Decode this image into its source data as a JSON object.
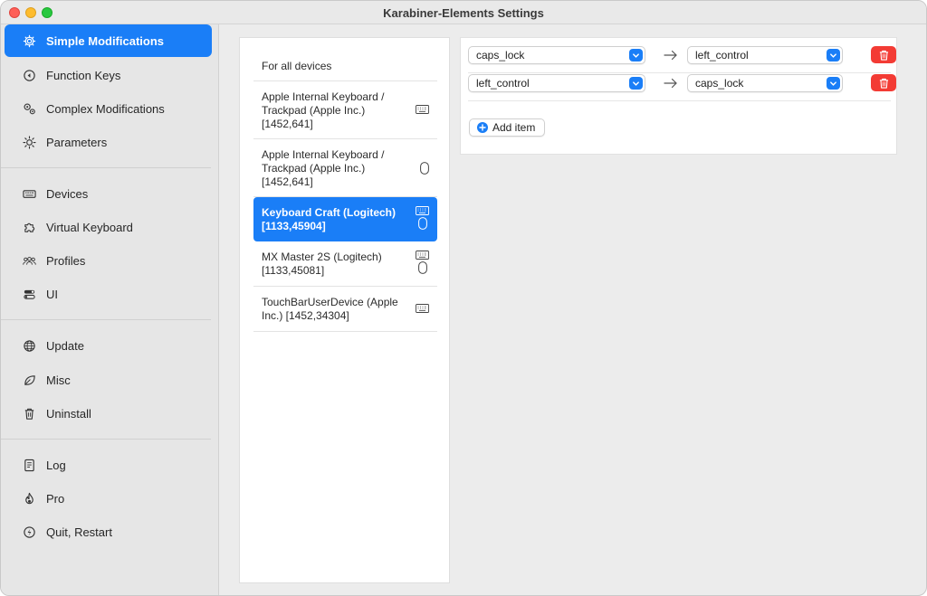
{
  "window": {
    "title": "Karabiner-Elements Settings"
  },
  "sidebar": {
    "items": [
      {
        "label": "Simple Modifications",
        "icon": "gear-icon",
        "selected": true
      },
      {
        "label": "Function Keys",
        "icon": "function-keys-icon"
      },
      {
        "label": "Complex Modifications",
        "icon": "gears-icon"
      },
      {
        "label": "Parameters",
        "icon": "sun-icon"
      },
      {
        "label": "Devices",
        "icon": "keyboard-icon"
      },
      {
        "label": "Virtual Keyboard",
        "icon": "puzzle-icon"
      },
      {
        "label": "Profiles",
        "icon": "people-icon"
      },
      {
        "label": "UI",
        "icon": "toggles-icon"
      },
      {
        "label": "Update",
        "icon": "globe-icon"
      },
      {
        "label": "Misc",
        "icon": "leaf-icon"
      },
      {
        "label": "Uninstall",
        "icon": "trash-icon"
      },
      {
        "label": "Log",
        "icon": "document-icon"
      },
      {
        "label": "Pro",
        "icon": "flame-icon"
      },
      {
        "label": "Quit, Restart",
        "icon": "power-icon"
      }
    ]
  },
  "devices": {
    "items": [
      {
        "label": "For all devices"
      },
      {
        "label": "Apple Internal Keyboard / Trackpad (Apple Inc.) [1452,641]",
        "icons": [
          "keyboard-icon"
        ]
      },
      {
        "label": "Apple Internal Keyboard / Trackpad (Apple Inc.) [1452,641]",
        "icons": [
          "mouse-icon"
        ]
      },
      {
        "label": "Keyboard Craft (Logitech) [1133,45904]",
        "icons": [
          "keyboard-icon",
          "mouse-icon"
        ],
        "selected": true
      },
      {
        "label": "MX Master 2S (Logitech) [1133,45081]",
        "icons": [
          "keyboard-icon",
          "mouse-icon"
        ]
      },
      {
        "label": "TouchBarUserDevice (Apple Inc.) [1452,34304]",
        "icons": [
          "keyboard-icon"
        ]
      }
    ]
  },
  "mappings": {
    "rows": [
      {
        "from": "caps_lock",
        "to": "left_control"
      },
      {
        "from": "left_control",
        "to": "caps_lock"
      }
    ],
    "add_label": "Add item"
  },
  "colors": {
    "accent": "#1a7ef7",
    "danger": "#f33b34",
    "traffic_close": "#fe5f57",
    "traffic_minimize": "#febc2e",
    "traffic_maximize": "#28c840"
  }
}
